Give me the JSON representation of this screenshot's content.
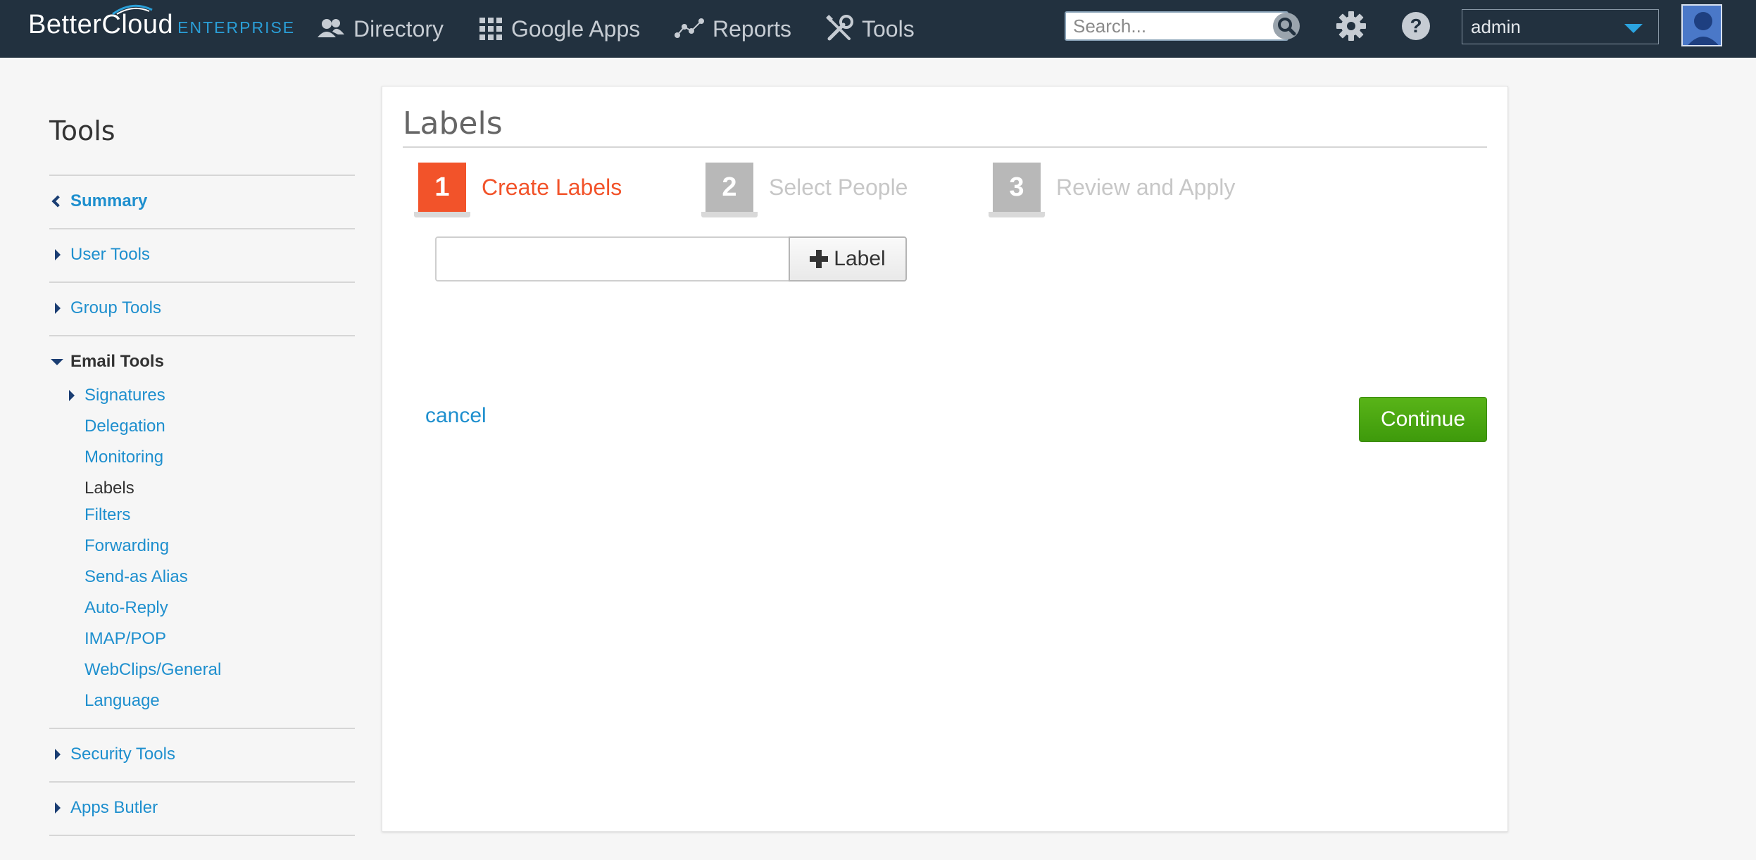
{
  "header": {
    "logo_main": "BetterCloud",
    "logo_sub": "ENTERPRISE",
    "nav": [
      {
        "label": "Directory",
        "icon": "people-icon"
      },
      {
        "label": "Google Apps",
        "icon": "grid-icon"
      },
      {
        "label": "Reports",
        "icon": "chart-icon"
      },
      {
        "label": "Tools",
        "icon": "tools-icon"
      }
    ],
    "search_placeholder": "Search...",
    "user": "admin",
    "colors": {
      "bar": "#22313f",
      "accent": "#2a9fd8"
    }
  },
  "sidebar": {
    "title": "Tools",
    "summary": "Summary",
    "user_tools": "User Tools",
    "group_tools": "Group Tools",
    "email_tools": "Email Tools",
    "email_items": [
      "Signatures",
      "Delegation",
      "Monitoring",
      "Labels",
      "Filters",
      "Forwarding",
      "Send-as Alias",
      "Auto-Reply",
      "IMAP/POP",
      "WebClips/General",
      "Language"
    ],
    "security_tools": "Security Tools",
    "apps_butler": "Apps Butler"
  },
  "main": {
    "title": "Labels",
    "steps": [
      {
        "num": "1",
        "label": "Create Labels",
        "state": "active"
      },
      {
        "num": "2",
        "label": "Select People",
        "state": "inactive"
      },
      {
        "num": "3",
        "label": "Review and Apply",
        "state": "inactive"
      }
    ],
    "label_input_value": "",
    "add_label_button": "Label",
    "cancel": "cancel",
    "continue": "Continue",
    "colors": {
      "active_step": "#f2532a",
      "continue": "#4aa70f",
      "link": "#1e8fce"
    }
  }
}
